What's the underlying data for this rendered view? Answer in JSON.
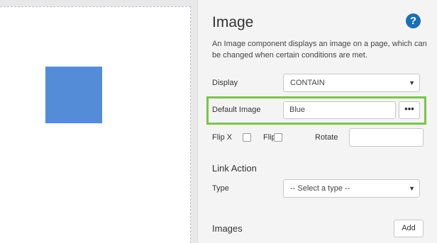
{
  "panel": {
    "title": "Image",
    "help_glyph": "?",
    "description": "An Image component displays an image on a page, which can be changed when certain conditions are met."
  },
  "display": {
    "label": "Display",
    "value": "CONTAIN",
    "arrow": "▼"
  },
  "default_image": {
    "label": "Default Image",
    "value": "Blue",
    "button_label": "•••"
  },
  "flip_rotate": {
    "flip_x_label": "Flip X",
    "flip_y_label": "Flip Y",
    "rotate_label": "Rotate",
    "rotate_value": ""
  },
  "link_action": {
    "title": "Link Action",
    "type_label": "Type",
    "type_value": "-- Select a type --",
    "arrow": "▼"
  },
  "images": {
    "title": "Images",
    "add_label": "Add"
  },
  "colors": {
    "highlight": "#7cc44a",
    "image_blue": "#558cd8",
    "help_blue": "#1a6fb5"
  }
}
